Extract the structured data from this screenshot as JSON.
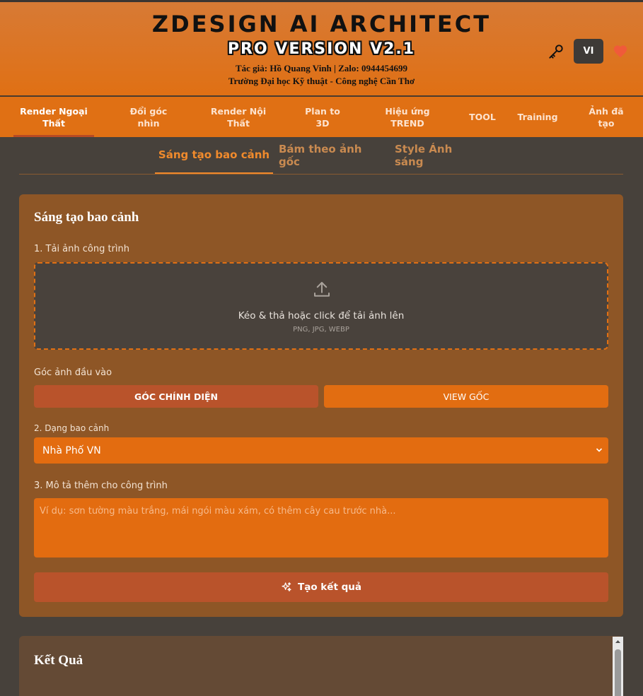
{
  "header": {
    "title": "ZDESIGN AI ARCHITECT",
    "subtitle": "PRO VERSION V2.1",
    "author": "Tác giả: Hồ Quang Vinh | Zalo: 0944454699",
    "school": "Trường Đại học Kỹ thuật - Công nghệ Cần Thơ",
    "lang": "VI",
    "icons": [
      "key-icon",
      "heart-icon"
    ]
  },
  "nav": {
    "items": [
      {
        "label": "Render Ngoại Thất"
      },
      {
        "label": "Đổi góc nhìn"
      },
      {
        "label": "Render Nội Thất"
      },
      {
        "label": "Plan to 3D"
      },
      {
        "label": "Hiệu ứng TREND"
      },
      {
        "label": "TOOL"
      },
      {
        "label": "Training"
      },
      {
        "label": "Ảnh đã tạo"
      }
    ],
    "active": "Render Ngoại Thất"
  },
  "subtabs": {
    "items": [
      {
        "label": "Sáng tạo bao cảnh"
      },
      {
        "label": "Bám theo ảnh gốc"
      },
      {
        "label": "Style Ánh sáng"
      }
    ],
    "active": "Sáng tạo bao cảnh"
  },
  "form": {
    "title": "Sáng tạo bao cảnh",
    "step1_label": "1. Tải ảnh công trình",
    "upload_text": "Kéo & thả hoặc click để tải ảnh lên",
    "upload_hint": "PNG, JPG, WEBP",
    "angle_label": "Góc ảnh đầu vào",
    "angle_options": [
      "GÓC CHÍNH DIỆN",
      "VIEW GỐC"
    ],
    "step2_label": "2. Dạng bao cảnh",
    "scene_value": "Nhà Phố VN",
    "step3_label": "3. Mô tả thêm cho công trình",
    "description_placeholder": "Ví dụ: sơn tường màu trắng, mái ngói màu xám, có thêm cây cau trước nhà...",
    "submit_label": "Tạo kết quả"
  },
  "result": {
    "title": "Kết Quả"
  },
  "colors": {
    "accent": "#e07014",
    "button": "#b9532b",
    "card": "#8e5626",
    "background": "#47413b"
  }
}
